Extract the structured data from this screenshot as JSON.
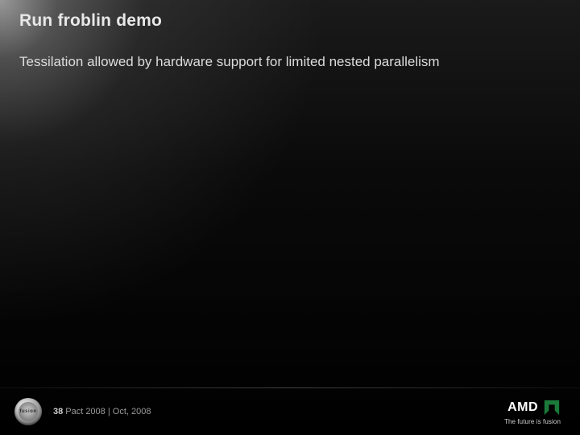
{
  "title": "Run froblin demo",
  "body": "Tessilation allowed by hardware support for limited nested parallelism",
  "footer": {
    "page_number": "38",
    "meta": "Pact 2008 | Oct, 2008",
    "fusion_label": "fusion"
  },
  "brand": {
    "name": "AMD",
    "tagline": "The future is fusion",
    "accent_color": "#1b7a3a"
  }
}
